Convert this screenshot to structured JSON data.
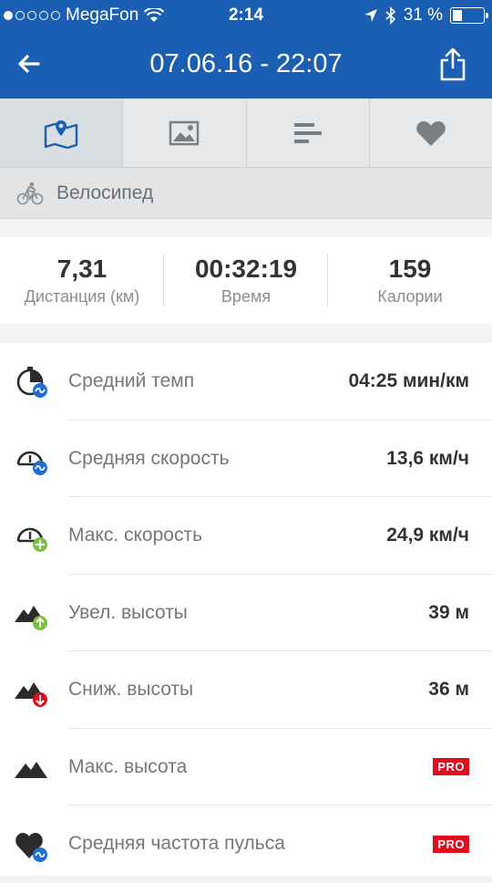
{
  "status": {
    "carrier": "MegaFon",
    "time": "2:14",
    "battery": "31 %",
    "signal_bars_filled": 1,
    "signal_bars_total": 5
  },
  "header": {
    "title": "07.06.16 - 22:07"
  },
  "tabs": [
    {
      "icon": "map-icon",
      "active": true
    },
    {
      "icon": "photo-icon",
      "active": false
    },
    {
      "icon": "stats-icon",
      "active": false
    },
    {
      "icon": "heart-icon",
      "active": false
    }
  ],
  "activity": {
    "icon": "bicycle-icon",
    "label": "Велосипед"
  },
  "summary": [
    {
      "value": "7,31",
      "label": "Дистанция (км)"
    },
    {
      "value": "00:32:19",
      "label": "Время"
    },
    {
      "value": "159",
      "label": "Калории"
    }
  ],
  "metrics": [
    {
      "icon": "pace-icon",
      "label": "Средний темп",
      "value": "04:25 мин/км"
    },
    {
      "icon": "speed-avg-icon",
      "label": "Средняя скорость",
      "value": "13,6 км/ч"
    },
    {
      "icon": "speed-max-icon",
      "label": "Макс. скорость",
      "value": "24,9 км/ч"
    },
    {
      "icon": "elevation-gain-icon",
      "label": "Увел. высоты",
      "value": "39 м"
    },
    {
      "icon": "elevation-loss-icon",
      "label": "Сниж. высоты",
      "value": "36 м"
    },
    {
      "icon": "elevation-max-icon",
      "label": "Макс. высота",
      "pro": "PRO"
    },
    {
      "icon": "heart-rate-icon",
      "label": "Средняя частота пульса",
      "pro": "PRO"
    }
  ],
  "colors": {
    "brand_blue": "#1a5fb4",
    "badge_blue": "#1e6fd9",
    "green": "#7ac143",
    "red": "#e00d1f"
  }
}
